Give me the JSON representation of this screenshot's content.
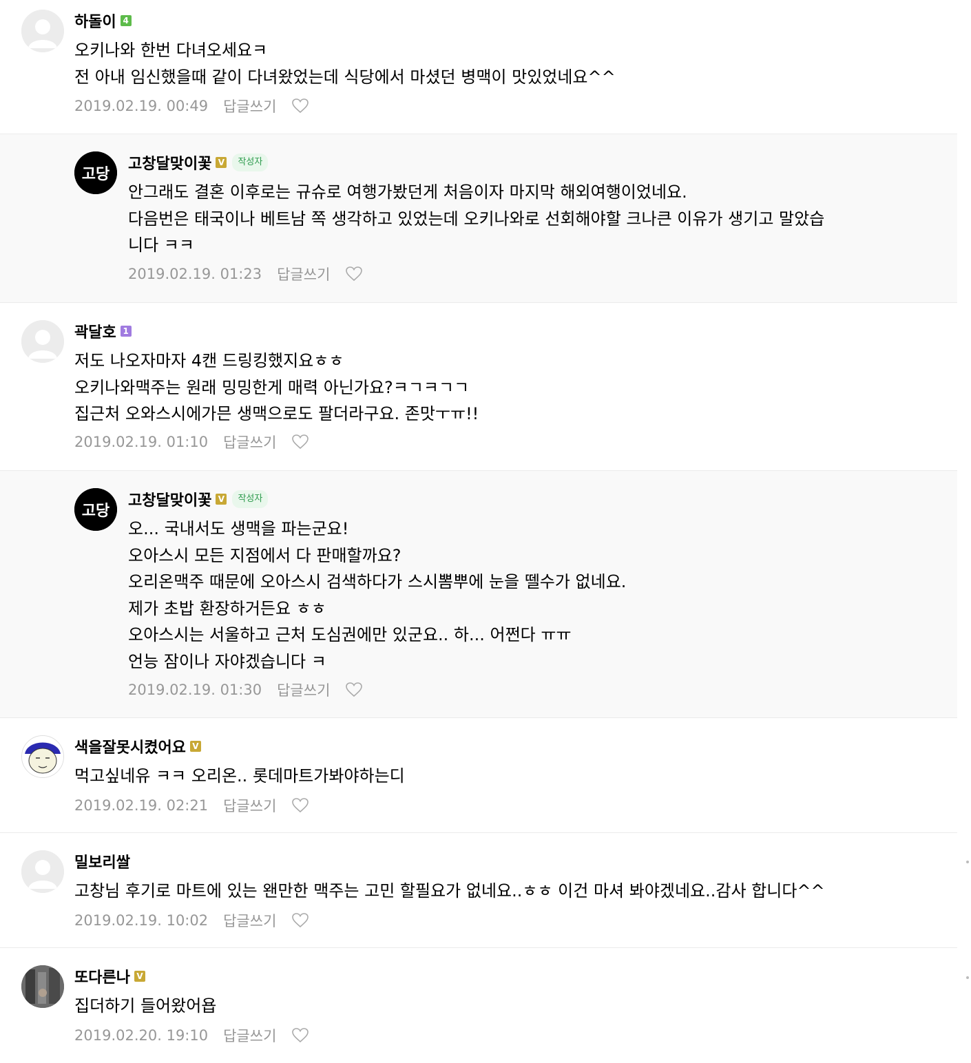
{
  "comments": [
    {
      "nickname": "하돌이",
      "badge": {
        "text": "4",
        "color": "#5dbb4a"
      },
      "author_tag": "",
      "lines": [
        "오키나와 한번 다녀오세요ㅋ",
        "전 아내 임신했을때 같이 다녀왔었는데 식당에서 마셨던 병맥이 맛있었네요^^"
      ],
      "date": "2019.02.19. 00:49",
      "reply_label": "답글쓰기",
      "avatar": "default-avatar-icon"
    },
    {
      "nickname": "고창달맞이꽃",
      "badge": {
        "text": "V",
        "color": "#c8a835"
      },
      "author_tag": "작성자",
      "lines": [
        "안그래도 결혼 이후로는 규슈로 여행가봤던게 처음이자 마지막 해외여행이었네요.",
        "다음번은 태국이나 베트남 쪽 생각하고 있었는데 오키나와로 선회해야할 크나큰 이유가 생기고 말았습",
        "니다 ㅋㅋ"
      ],
      "date": "2019.02.19. 01:23",
      "reply_label": "답글쓰기",
      "avatar": "logo-avatar-icon"
    },
    {
      "nickname": "곽달호",
      "badge": {
        "text": "1",
        "color": "#a07be0"
      },
      "author_tag": "",
      "lines": [
        "저도 나오자마자 4캔 드링킹했지요ㅎㅎ",
        "오키나와맥주는 원래 밍밍한게 매력 아닌가요?ㅋㄱㅋㄱㄱ",
        "집근처 오와스시에가믄 생맥으로도 팔더라구요. 존맛ㅜㅠ!!"
      ],
      "date": "2019.02.19. 01:10",
      "reply_label": "답글쓰기",
      "avatar": "default-avatar-icon"
    },
    {
      "nickname": "고창달맞이꽃",
      "badge": {
        "text": "V",
        "color": "#c8a835"
      },
      "author_tag": "작성자",
      "lines": [
        "오... 국내서도 생맥을 파는군요!",
        "오아스시 모든 지점에서 다 판매할까요?",
        "오리온맥주 때문에 오아스시 검색하다가 스시뽐뿌에 눈을 뗄수가 없네요.",
        "제가 초밥 환장하거든요 ㅎㅎ",
        "오아스시는 서울하고 근처 도심권에만 있군요.. 하... 어쩐다 ㅠㅠ",
        "언능 잠이나 자야겠습니다 ㅋ"
      ],
      "date": "2019.02.19. 01:30",
      "reply_label": "답글쓰기",
      "avatar": "logo-avatar-icon"
    },
    {
      "nickname": "색을잘못시켰어요",
      "badge": {
        "text": "V",
        "color": "#c8a835"
      },
      "author_tag": "",
      "lines": [
        "먹고싶네유 ㅋㅋ 오리온.. 롯데마트가봐야하는디"
      ],
      "date": "2019.02.19. 02:21",
      "reply_label": "답글쓰기",
      "avatar": "cartoon-avatar-icon"
    },
    {
      "nickname": "밀보리쌀",
      "badge": null,
      "author_tag": "",
      "lines": [
        "고창님 후기로 마트에 있는 왠만한 맥주는 고민 할필요가 없네요..ㅎㅎ 이건 마셔 봐야겠네요..감사 합니다^^"
      ],
      "date": "2019.02.19. 10:02",
      "reply_label": "답글쓰기",
      "avatar": "default-avatar-icon"
    },
    {
      "nickname": "또다른나",
      "badge": {
        "text": "V",
        "color": "#c8a835"
      },
      "author_tag": "",
      "lines": [
        "집더하기 들어왔어욥"
      ],
      "date": "2019.02.20. 19:10",
      "reply_label": "답글쓰기",
      "avatar": "photo-avatar-icon"
    }
  ],
  "logo_text": "고당",
  "colors": {
    "reply_bg": "#f9f9f9",
    "meta": "#979797",
    "author_tag_bg": "#e9f7ec",
    "author_tag_fg": "#2e9b4e"
  }
}
